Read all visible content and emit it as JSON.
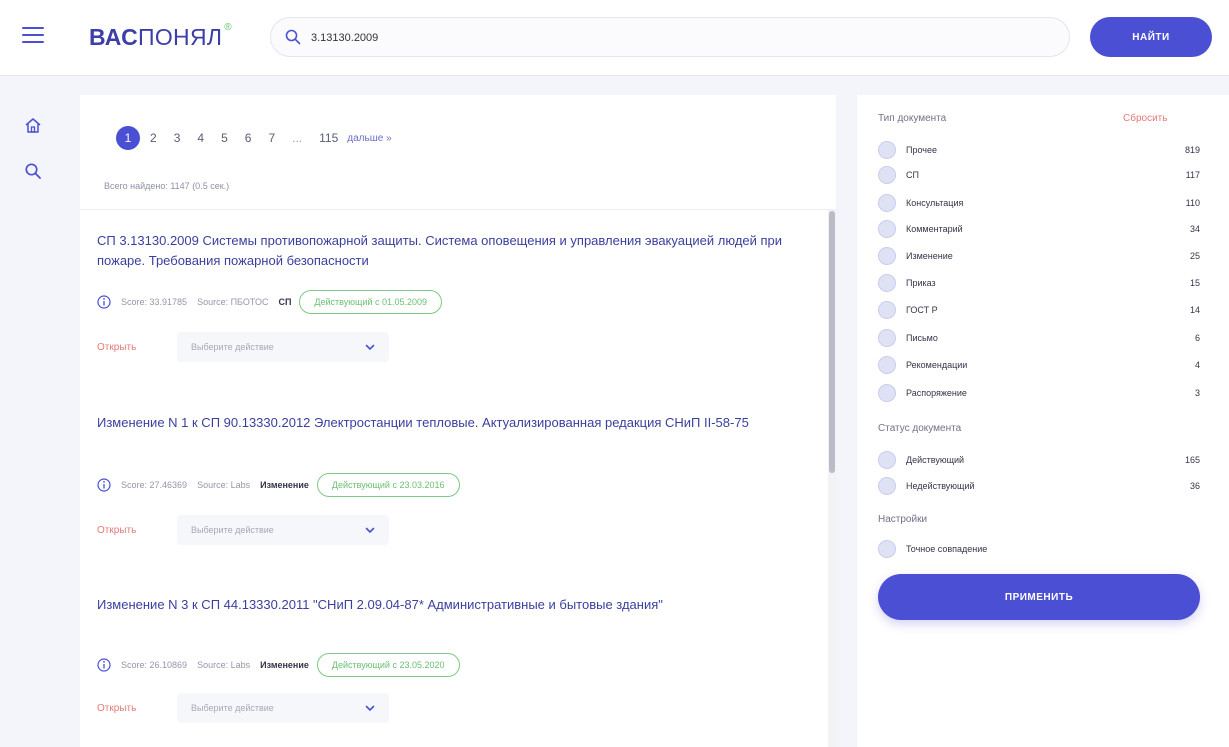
{
  "header": {
    "logo_bold": "ВАС",
    "logo_rest": "ПОНЯЛ",
    "logo_sup": "®",
    "search_value": "3.13130.2009",
    "find_label": "НАЙТИ"
  },
  "pagination": {
    "pages": [
      "1",
      "2",
      "3",
      "4",
      "5",
      "6",
      "7",
      "...",
      "115"
    ],
    "active": "1",
    "next_label": "дальше »"
  },
  "results_total": "Всего найдено: 1147 (0.5 сек.)",
  "results": [
    {
      "title": "СП 3.13130.2009 Системы противопожарной защиты. Система оповещения и управления эвакуацией людей при пожаре. Требования пожарной безопасности",
      "score": "Score: 33.91785",
      "source": "Source: ПБОТОС",
      "type": "СП",
      "status": "Действующий с 01.05.2009",
      "open_label": "Открыть",
      "action_placeholder": "Выберите действие"
    },
    {
      "title": "Изменение N 1 к СП 90.13330.2012 Электростанции тепловые. Актуализированная редакция СНиП II-58-75",
      "score": "Score: 27.46369",
      "source": "Source: Labs",
      "type": "Изменение",
      "status": "Действующий с 23.03.2016",
      "open_label": "Открыть",
      "action_placeholder": "Выберите действие"
    },
    {
      "title": "Изменение N 3 к СП 44.13330.2011 \"СНиП 2.09.04-87* Административные и бытовые здания\"",
      "score": "Score: 26.10869",
      "source": "Source: Labs",
      "type": "Изменение",
      "status": "Действующий с 23.05.2020",
      "open_label": "Открыть",
      "action_placeholder": "Выберите действие"
    }
  ],
  "filters": {
    "doc_type_title": "Тип документа",
    "reset_label": "Сбросить",
    "doc_types": [
      {
        "label": "Прочее",
        "count": "819"
      },
      {
        "label": "СП",
        "count": "117"
      },
      {
        "label": "Консультация",
        "count": "110"
      },
      {
        "label": "Комментарий",
        "count": "34"
      },
      {
        "label": "Изменение",
        "count": "25"
      },
      {
        "label": "Приказ",
        "count": "15"
      },
      {
        "label": "ГОСТ Р",
        "count": "14"
      },
      {
        "label": "Письмо",
        "count": "6"
      },
      {
        "label": "Рекомендации",
        "count": "4"
      },
      {
        "label": "Распоряжение",
        "count": "3"
      }
    ],
    "status_title": "Статус документа",
    "statuses": [
      {
        "label": "Действующий",
        "count": "165"
      },
      {
        "label": "Недействующий",
        "count": "36"
      }
    ],
    "settings_title": "Настройки",
    "settings": [
      {
        "label": "Точное совпадение"
      }
    ],
    "apply_label": "ПРИМЕНИТЬ"
  },
  "colors": {
    "accent": "#4a4fd4",
    "link": "#3b3f9e",
    "status_green": "#6cbf74",
    "open_red": "#e37a7a"
  }
}
